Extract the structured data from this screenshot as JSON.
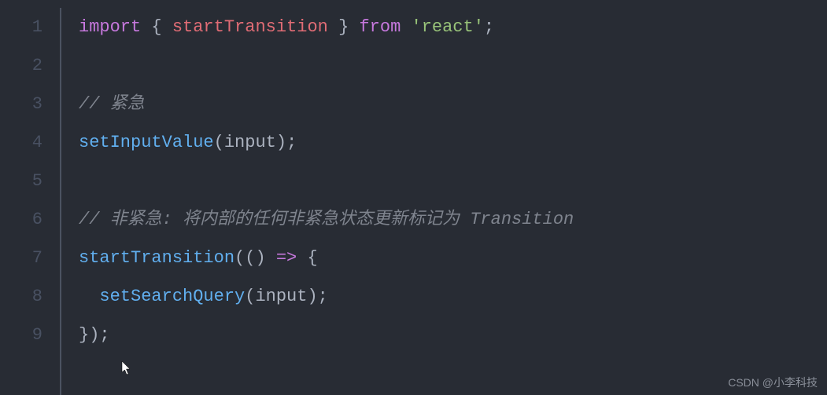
{
  "gutter": [
    "1",
    "2",
    "3",
    "4",
    "5",
    "6",
    "7",
    "8",
    "9"
  ],
  "code": {
    "l1": {
      "kw1": "import",
      "brace1": " { ",
      "ident": "startTransition",
      "brace2": " } ",
      "kw2": "from",
      "sp": " ",
      "str": "'react'",
      "semi": ";"
    },
    "l3": {
      "cmt": "// 紧急"
    },
    "l4": {
      "fn": "setInputValue",
      "open": "(",
      "arg": "input",
      "close": ")",
      "semi": ";"
    },
    "l6": {
      "cmt": "// 非紧急: 将内部的任何非紧急状态更新标记为 Transition"
    },
    "l7": {
      "fn": "startTransition",
      "open": "(",
      "paren1": "(",
      "paren2": ")",
      "arrow": " => ",
      "brace": "{"
    },
    "l8": {
      "indent": "  ",
      "fn": "setSearchQuery",
      "open": "(",
      "arg": "input",
      "close": ")",
      "semi": ";"
    },
    "l9": {
      "close": "})",
      "semi": ";"
    }
  },
  "watermark": "CSDN @小李科技"
}
